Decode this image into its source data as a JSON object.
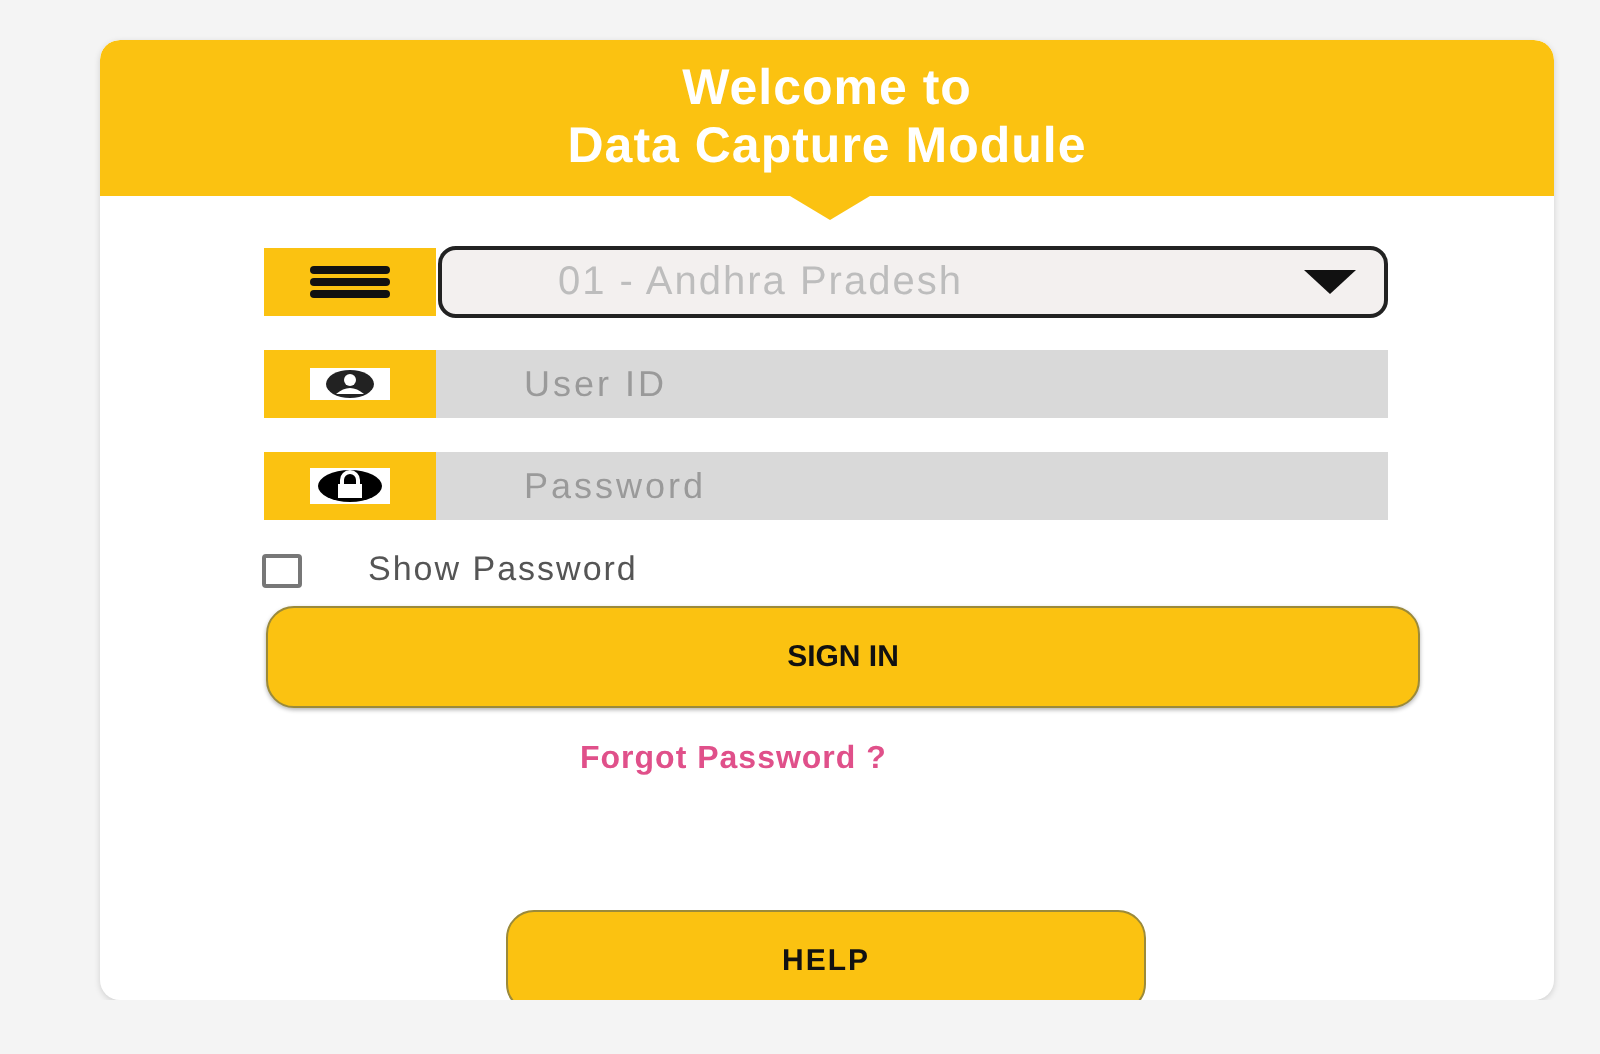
{
  "header": {
    "title_lines": [
      "Welcome to",
      "Data Capture Module"
    ]
  },
  "fields": [
    {
      "kind": "dropdown",
      "value": "01 - Andhra Pradesh"
    },
    {
      "kind": "text",
      "placeholder": "User ID"
    },
    {
      "kind": "password",
      "placeholder": "Password"
    }
  ],
  "show_password": {
    "label": "Show Password",
    "checked": false
  },
  "sign_in": "SIGN IN",
  "forgot": "Forgot Password ?",
  "help": "HELP"
}
